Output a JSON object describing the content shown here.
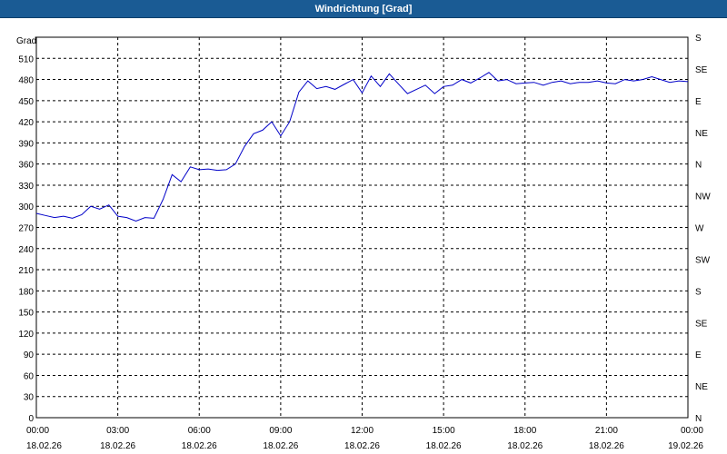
{
  "window": {
    "title": "Windrichtung [Grad]"
  },
  "chart_data": {
    "type": "line",
    "title": "Windrichtung [Grad]",
    "ylabel": "Grad",
    "ylim": [
      0,
      540
    ],
    "y_ticks": [
      0,
      30,
      60,
      90,
      120,
      150,
      180,
      210,
      240,
      270,
      300,
      330,
      360,
      390,
      420,
      450,
      480,
      510
    ],
    "right_axis_labels": [
      "N",
      "NE",
      "E",
      "SE",
      "S",
      "SW",
      "W",
      "NW",
      "N",
      "NE",
      "E",
      "SE",
      "S"
    ],
    "x_ticks": [
      {
        "time": "00:00",
        "date": "18.02.26"
      },
      {
        "time": "03:00",
        "date": "18.02.26"
      },
      {
        "time": "06:00",
        "date": "18.02.26"
      },
      {
        "time": "09:00",
        "date": "18.02.26"
      },
      {
        "time": "12:00",
        "date": "18.02.26"
      },
      {
        "time": "15:00",
        "date": "18.02.26"
      },
      {
        "time": "18:00",
        "date": "18.02.26"
      },
      {
        "time": "21:00",
        "date": "18.02.26"
      },
      {
        "time": "00:00",
        "date": "19.02.26"
      }
    ],
    "xlim_hours": [
      0,
      24
    ],
    "grid": true,
    "series": [
      {
        "color": "#0000c8",
        "hours": [
          0,
          0.33,
          0.67,
          1,
          1.33,
          1.67,
          2,
          2.33,
          2.67,
          3,
          3.33,
          3.67,
          4,
          4.33,
          4.67,
          5,
          5.33,
          5.67,
          6,
          6.33,
          6.67,
          7,
          7.33,
          7.67,
          8,
          8.33,
          8.67,
          9,
          9.33,
          9.67,
          10,
          10.33,
          10.67,
          11,
          11.33,
          11.67,
          12,
          12.33,
          12.67,
          13,
          13.33,
          13.67,
          14,
          14.33,
          14.67,
          15,
          15.33,
          15.67,
          16,
          16.33,
          16.67,
          17,
          17.33,
          17.67,
          18,
          18.33,
          18.67,
          19,
          19.33,
          19.67,
          20,
          20.33,
          20.67,
          21,
          21.33,
          21.67,
          22,
          22.33,
          22.67,
          23,
          23.33,
          23.67,
          24
        ],
        "values": [
          290,
          287,
          284,
          286,
          283,
          288,
          300,
          296,
          302,
          286,
          284,
          279,
          284,
          283,
          310,
          345,
          335,
          356,
          352,
          353,
          351,
          352,
          360,
          385,
          403,
          408,
          420,
          400,
          420,
          462,
          478,
          467,
          470,
          466,
          473,
          480,
          461,
          485,
          470,
          488,
          474,
          460,
          466,
          472,
          460,
          470,
          472,
          480,
          475,
          482,
          490,
          478,
          480,
          474,
          475,
          476,
          472,
          476,
          478,
          474,
          476,
          476,
          478,
          475,
          474,
          480,
          478,
          480,
          484,
          480,
          476,
          478,
          477
        ]
      }
    ]
  }
}
